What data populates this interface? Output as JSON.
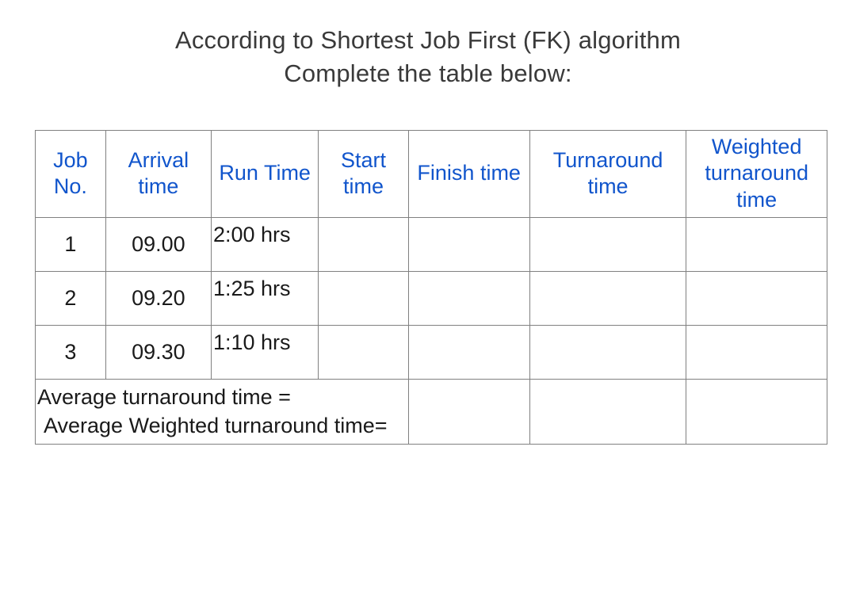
{
  "heading_line1": "According to Shortest Job First (FK) algorithm",
  "heading_line2": "Complete the table below:",
  "headers": {
    "job_no": "Job No.",
    "arrival": "Arrival time",
    "run": "Run Time",
    "start": "Start time",
    "finish": "Finish time",
    "turnaround": "Turnaround time",
    "weighted": "Weighted turnaround time"
  },
  "rows": [
    {
      "job": "1",
      "arrival": "09.00",
      "run": "2:00 hrs",
      "start": "",
      "finish": "",
      "turnaround": "",
      "weighted": ""
    },
    {
      "job": "2",
      "arrival": "09.20",
      "run": "1:25 hrs",
      "start": "",
      "finish": "",
      "turnaround": "",
      "weighted": ""
    },
    {
      "job": "3",
      "arrival": "09.30",
      "run": "1:10 hrs",
      "start": "",
      "finish": "",
      "turnaround": "",
      "weighted": ""
    }
  ],
  "footer": {
    "avg_turnaround": "Average turnaround time =",
    "avg_weighted": "Average Weighted turnaround time="
  },
  "chart_data": {
    "type": "table",
    "title": "Shortest Job First (FK) algorithm",
    "columns": [
      "Job No.",
      "Arrival time",
      "Run Time",
      "Start time",
      "Finish time",
      "Turnaround time",
      "Weighted turnaround time"
    ],
    "rows": [
      [
        "1",
        "09.00",
        "2:00 hrs",
        "",
        "",
        "",
        ""
      ],
      [
        "2",
        "09.20",
        "1:25 hrs",
        "",
        "",
        "",
        ""
      ],
      [
        "3",
        "09.30",
        "1:10 hrs",
        "",
        "",
        "",
        ""
      ]
    ],
    "footer": [
      "Average turnaround time =",
      "Average Weighted turnaround time="
    ]
  }
}
